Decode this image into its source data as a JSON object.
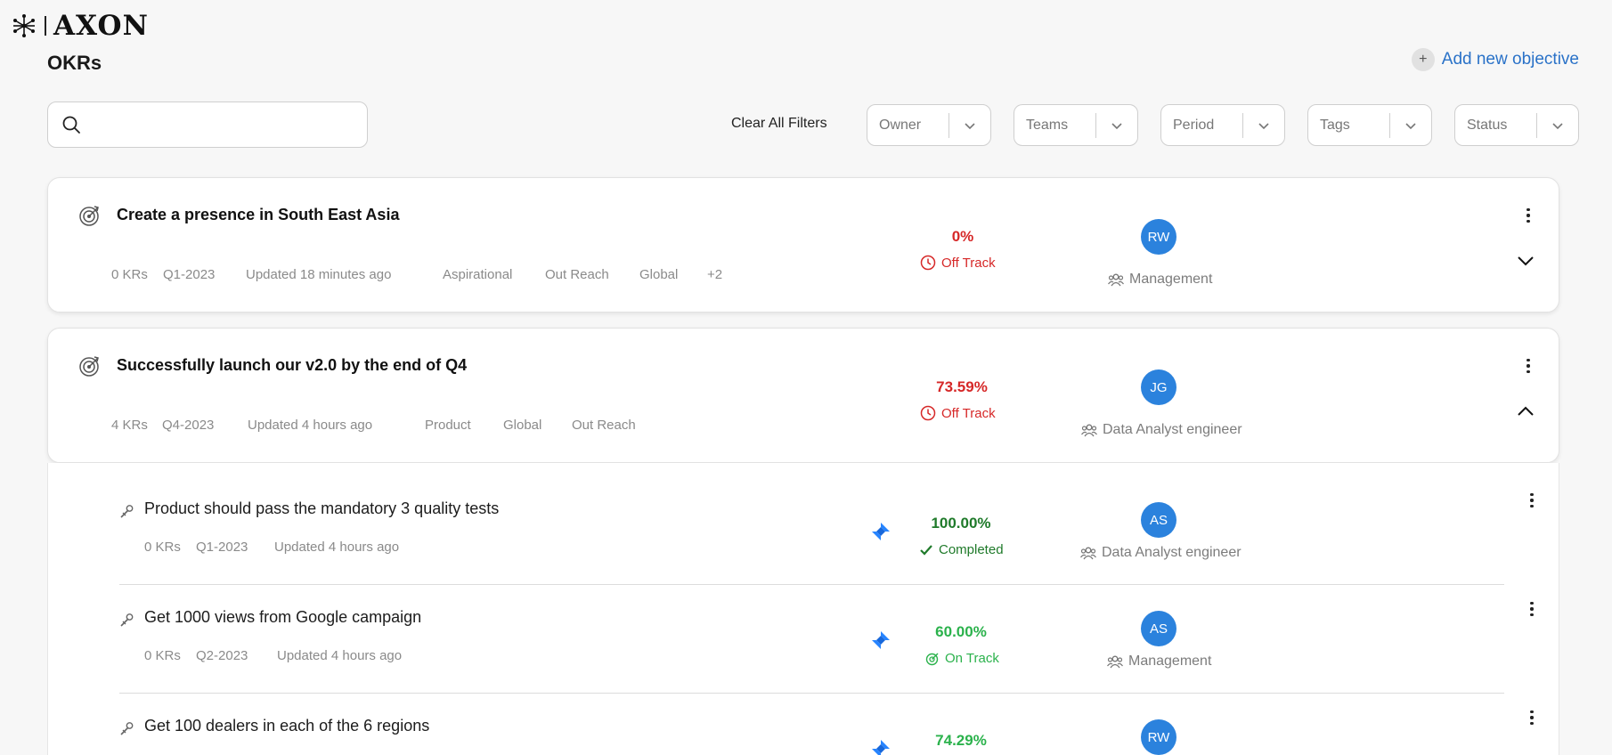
{
  "brand": {
    "name": "AXON"
  },
  "header": {
    "title": "OKRs",
    "add_objective": "Add new objective",
    "add_plus": "+"
  },
  "search": {
    "placeholder": ""
  },
  "filters": {
    "clear_all": "Clear All Filters",
    "items": [
      {
        "label": "Owner"
      },
      {
        "label": "Teams"
      },
      {
        "label": "Period"
      },
      {
        "label": "Tags"
      },
      {
        "label": "Status"
      }
    ]
  },
  "objectives": [
    {
      "title": "Create a presence in South East Asia",
      "krs": "0 KRs",
      "period": "Q1-2023",
      "updated": "Updated 18 minutes ago",
      "tags": [
        "Aspirational",
        "Out Reach",
        "Global",
        "+2"
      ],
      "progress": "0%",
      "status": "Off Track",
      "owner_initials": "RW",
      "team": "Management",
      "expanded": false
    },
    {
      "title": "Successfully launch our v2.0 by the end of Q4",
      "krs": "4 KRs",
      "period": "Q4-2023",
      "updated": "Updated 4 hours ago",
      "tags": [
        "Product",
        "Global",
        "Out Reach"
      ],
      "progress": "73.59%",
      "status": "Off Track",
      "owner_initials": "JG",
      "team": "Data Analyst engineer",
      "expanded": true
    }
  ],
  "key_results": [
    {
      "title": "Product should pass the mandatory 3 quality tests",
      "krs": "0 KRs",
      "period": "Q1-2023",
      "updated": "Updated 4 hours ago",
      "progress": "100.00%",
      "status": "Completed",
      "owner_initials": "AS",
      "team": "Data Analyst engineer"
    },
    {
      "title": "Get 1000 views from Google campaign",
      "krs": "0 KRs",
      "period": "Q2-2023",
      "updated": "Updated 4 hours ago",
      "progress": "60.00%",
      "status": "On Track",
      "owner_initials": "AS",
      "team": "Management"
    },
    {
      "title": "Get 100 dealers in each of the 6 regions",
      "progress": "74.29%",
      "owner_initials": "RW"
    }
  ],
  "colors": {
    "off_track": "#d62828",
    "completed": "#1f7a2a",
    "on_track": "#2bb24c",
    "accent": "#2a72c8",
    "avatar": "#2b82dd"
  }
}
